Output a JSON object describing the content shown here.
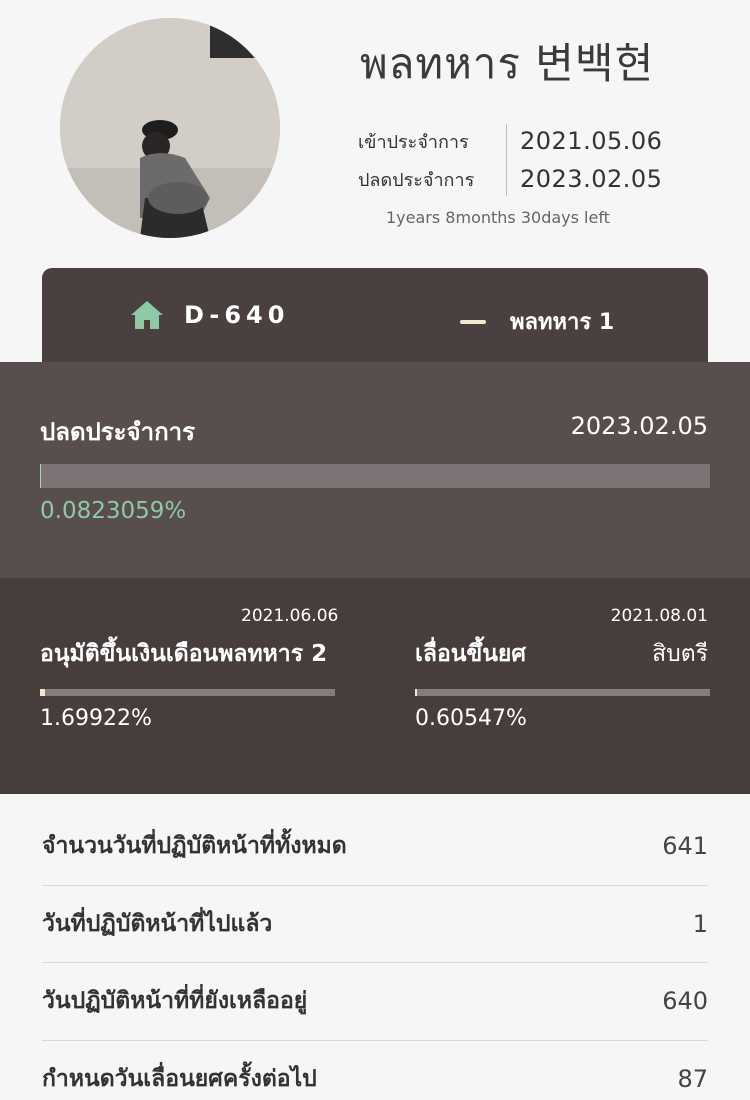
{
  "profile": {
    "name": "พลทหาร 변백현",
    "enlist_label": "เข้าประจำการ",
    "enlist_date": "2021.05.06",
    "discharge_label": "ปลดประจำการ",
    "discharge_date": "2023.02.05",
    "remaining_text": "1years 8months 30days left"
  },
  "tabs": {
    "dday": "D-640",
    "rank": "พลทหาร 1"
  },
  "discharge_progress": {
    "label": "ปลดประจำการ",
    "date": "2023.02.05",
    "percent_text": "0.0823059%",
    "progress_percent": 0.0823059
  },
  "salary_progress": {
    "date": "2021.06.06",
    "label": "อนุมัติขึ้นเงินเดือนพลทหาร 2",
    "percent_text": "1.69922%",
    "progress_percent": 1.69922
  },
  "promotion_progress": {
    "date": "2021.08.01",
    "label": "เลื่อนขึ้นยศ",
    "target": "สิบตรี",
    "percent_text": "0.60547%",
    "progress_percent": 0.60547
  },
  "stats": [
    {
      "label": "จำนวนวันที่ปฏิบัติหน้าที่ทั้งหมด",
      "value": "641"
    },
    {
      "label": "วันที่ปฏิบัติหน้าที่ไปแล้ว",
      "value": "1"
    },
    {
      "label": "วันปฏิบัติหน้าที่ที่ยังเหลืออยู่",
      "value": "640"
    },
    {
      "label": "กำหนดวันเลื่อนยศครั้งต่อไป",
      "value": "87"
    }
  ],
  "colors": {
    "card_dark": "#4b4040",
    "panel_mid": "#594e4e",
    "panel_dark": "#473d3d",
    "accent_green": "#8ec9a5",
    "accent_cream": "#f3e7cf"
  },
  "icons": {
    "dday": "home-icon",
    "rank": "rank-bar-icon"
  }
}
